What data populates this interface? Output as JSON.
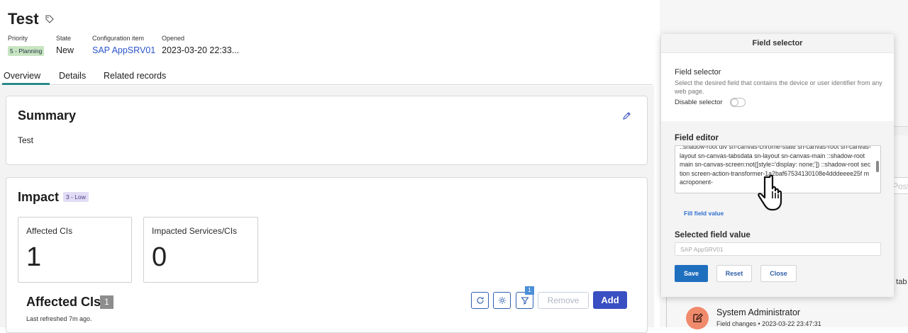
{
  "header": {
    "title": "Test",
    "priority_label": "Priority",
    "priority_value": "5 - Planning",
    "state_label": "State",
    "state_value": "New",
    "ci_label": "Configuration item",
    "ci_value": "SAP AppSRV01",
    "opened_label": "Opened",
    "opened_value": "2023-03-20 22:33..."
  },
  "tabs": [
    {
      "label": "Overview",
      "active": true
    },
    {
      "label": "Details",
      "active": false
    },
    {
      "label": "Related records",
      "active": false
    }
  ],
  "summary": {
    "title": "Summary",
    "text": "Test"
  },
  "impact": {
    "title": "Impact",
    "badge": "3 - Low",
    "cards": [
      {
        "label": "Affected CIs",
        "value": "1"
      },
      {
        "label": "Impacted Services/CIs",
        "value": "0"
      }
    ]
  },
  "affected_cis": {
    "title": "Affected CIs",
    "count": "1",
    "refreshed": "Last refreshed 7m ago.",
    "filter_count": "1",
    "remove_label": "Remove",
    "add_label": "Add"
  },
  "activity": {
    "author": "System Administrator",
    "detail": "Field changes • 2023-03-22 23:47:31",
    "post_label": "Post",
    "partial_text": "' tab"
  },
  "popup": {
    "header": "Field selector",
    "selector_title": "Field selector",
    "selector_desc": "Select the desired field that contains the device or user identifier from any web page.",
    "disable_label": "Disable selector",
    "editor_title": "Field editor",
    "editor_value": "::shadow-root div sn-canvas-chrome-state sn-canvas-root sn-canvas-layout sn-canvas-tabsdata sn-layout sn-canvas-main ::shadow-root main sn-canvas-screen:not([style='display: none;']) ::shadow-root section screen-action-transformer-1a2baf67534130108e4dddeeee25f macroponent-",
    "fill_link": "Fill field value",
    "selected_title": "Selected field value",
    "selected_value": "SAP AppSRV01",
    "save": "Save",
    "reset": "Reset",
    "close": "Close"
  },
  "colors": {
    "accent": "#3a4fc1",
    "tab_underline": "#2b8a8a",
    "planning_badge": "#c7e5c1",
    "low_badge": "#e2dcf5",
    "save_button": "#1f6fbf",
    "avatar": "#f08a6c"
  },
  "icons": [
    "tag-icon",
    "pencil-icon",
    "refresh-icon",
    "gear-icon",
    "filter-icon",
    "edit-note-icon",
    "hand-cursor-icon"
  ]
}
